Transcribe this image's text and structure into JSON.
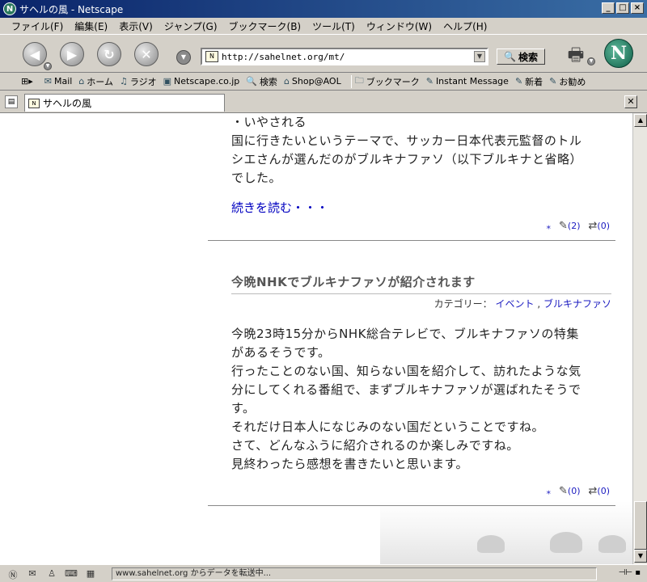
{
  "window": {
    "title": "サヘルの風 - Netscape"
  },
  "menu": [
    "ファイル(F)",
    "編集(E)",
    "表示(V)",
    "ジャンプ(G)",
    "ブックマーク(B)",
    "ツール(T)",
    "ウィンドウ(W)",
    "ヘルプ(H)"
  ],
  "nav": {
    "url": "http://sahelnet.org/mt/",
    "search_label": "検索"
  },
  "personal_toolbar": [
    "Mail",
    "ホーム",
    "ラジオ",
    "Netscape.co.jp",
    "検索",
    "Shop@AOL",
    "ブックマーク",
    "Instant Message",
    "新着",
    "お勧め"
  ],
  "tab": {
    "label": "サヘルの風"
  },
  "post1": {
    "lines": [
      "・いやされる",
      "国に行きたいというテーマで、サッカー日本代表元監督のトル",
      "シエさんが選んだのがブルキナファソ（以下ブルキナと省略）",
      "でした。"
    ],
    "read_more": "続きを読む・・・",
    "comments": "(2)",
    "trackbacks": "(0)"
  },
  "post2": {
    "title": "今晩NHKでブルキナファソが紹介されます",
    "category_label": "カテゴリー：",
    "categories": [
      "イベント",
      "ブルキナファソ"
    ],
    "category_sep": ",",
    "lines": [
      "今晩23時15分からNHK総合テレビで、ブルキナファソの特集",
      "があるそうです。",
      "行ったことのない国、知らない国を紹介して、訪れたような気",
      "分にしてくれる番組で、まずブルキナファソが選ばれたそうで",
      "す。",
      "それだけ日本人になじみのない国だということですね。",
      "さて、どんなふうに紹介されるのか楽しみですね。",
      "見終わったら感想を書きたいと思います。"
    ],
    "comments": "(0)",
    "trackbacks": "(0)"
  },
  "status": {
    "text": "www.sahelnet.org からデータを転送中..."
  }
}
